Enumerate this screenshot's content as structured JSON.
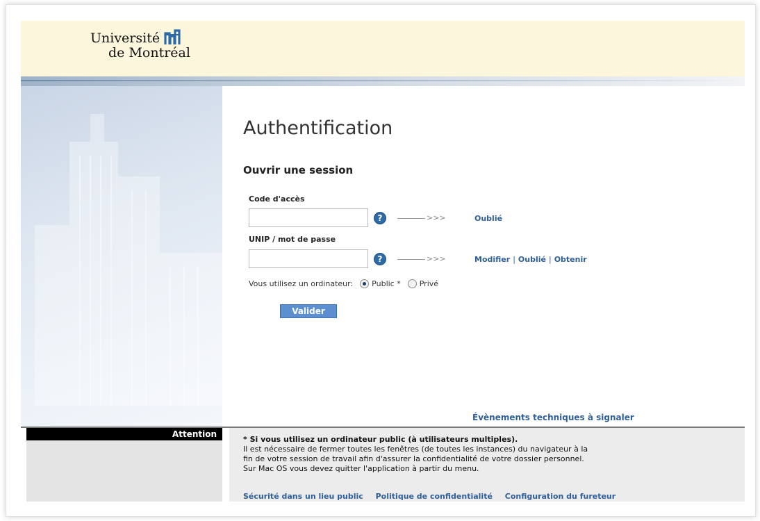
{
  "brand": {
    "line1": "Université",
    "line2": "de Montréal",
    "accent": "#2e6aa6"
  },
  "page": {
    "title": "Authentification",
    "subtitle": "Ouvrir une session"
  },
  "login": {
    "code_label": "Code d'accès",
    "code_value": "",
    "password_label": "UNIP / mot de passe",
    "password_value": "",
    "help_glyph": "?",
    "arrow_text": ">>>",
    "code_links": [
      "Oublié"
    ],
    "password_links": [
      "Modifier",
      "Oublié",
      "Obtenir"
    ],
    "link_separator": "|",
    "computer_label": "Vous utilisez un ordinateur:",
    "options": [
      {
        "label": "Public *",
        "selected": true
      },
      {
        "label": "Privé",
        "selected": false
      }
    ],
    "submit_label": "Valider"
  },
  "tech_events_link": "Évènements techniques à signaler",
  "attention": {
    "label": "Attention",
    "heading": "* Si vous utilisez un ordinateur public (à utilisateurs multiples).",
    "lines": [
      "Il est nécessaire de fermer toutes les fenêtres (de toutes les instances) du navigateur à la",
      "fin de votre session de travail afin d'assurer la confidentialité de votre dossier personnel.",
      "Sur Mac OS vous devez quitter l'application à partir du menu."
    ]
  },
  "footer_links": [
    "Sécurité dans un lieu public",
    "Politique de confidentialité",
    "Configuration du fureteur"
  ]
}
